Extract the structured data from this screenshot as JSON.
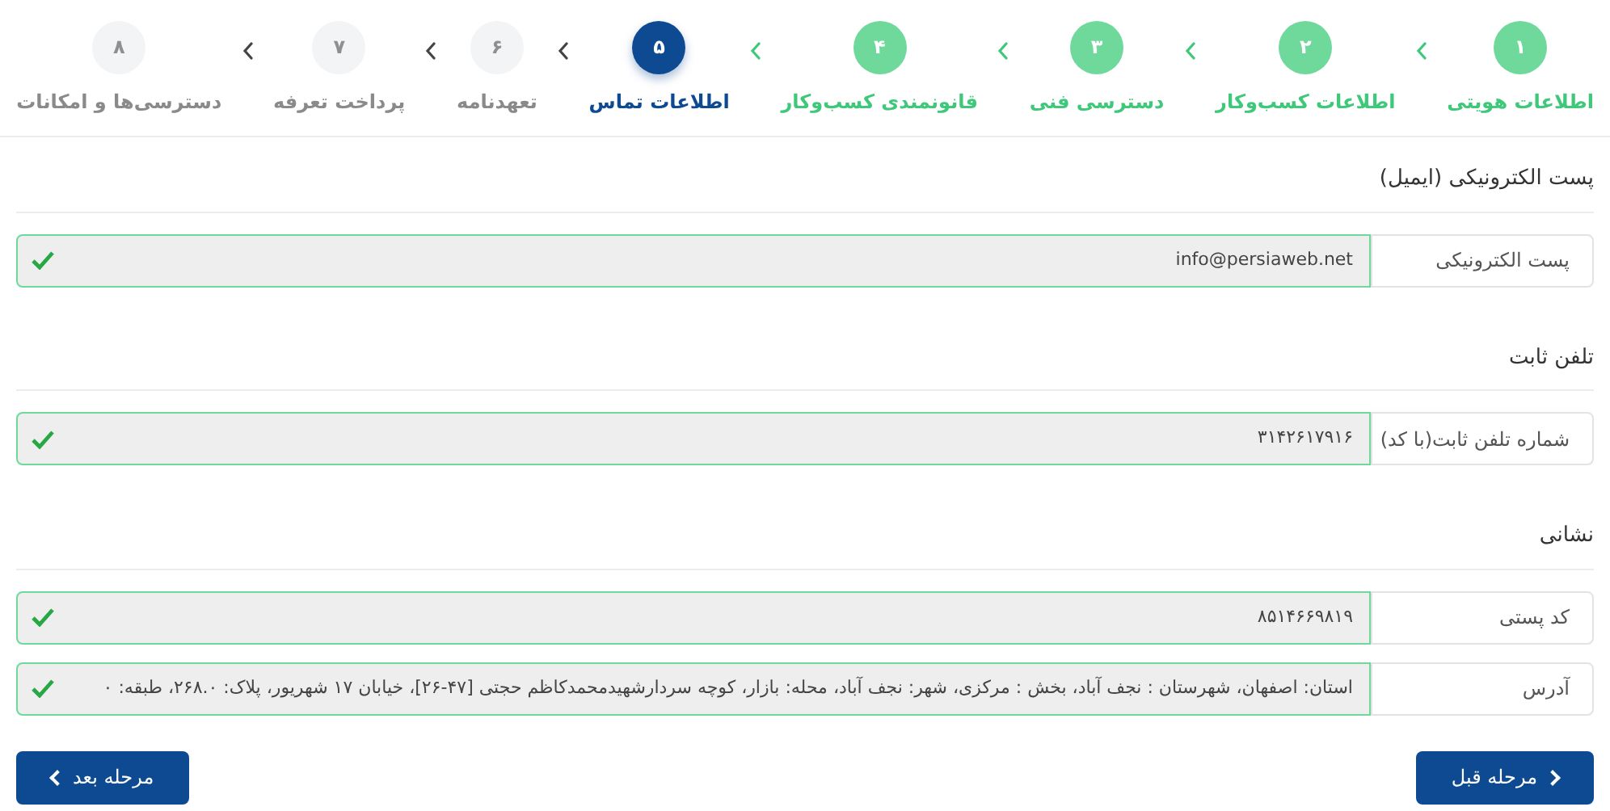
{
  "steps": [
    {
      "number": "۱",
      "label": "اطلاعات هویتی",
      "completed": true,
      "selected": false
    },
    {
      "number": "۲",
      "label": "اطلاعات کسب‌وکار",
      "completed": true,
      "selected": false
    },
    {
      "number": "۳",
      "label": "دسترسی فنی",
      "completed": true,
      "selected": false
    },
    {
      "number": "۴",
      "label": "قانونمندی کسب‌وکار",
      "completed": true,
      "selected": false
    },
    {
      "number": "۵",
      "label": "اطلاعات تماس",
      "completed": false,
      "selected": true
    },
    {
      "number": "۶",
      "label": "تعهدنامه",
      "completed": false,
      "selected": false
    },
    {
      "number": "۷",
      "label": "پرداخت تعرفه",
      "completed": false,
      "selected": false
    },
    {
      "number": "۸",
      "label": "دسترسی‌ها و امکانات",
      "completed": false,
      "selected": false
    }
  ],
  "sections": [
    {
      "title": "پست الکترونیکی (ایمیل)",
      "fields": [
        {
          "label": "پست الکترونیکی",
          "value": "info@persiaweb.net",
          "valid": true
        }
      ]
    },
    {
      "title": "تلفن ثابت",
      "fields": [
        {
          "label": "شماره تلفن ثابت(با کد)",
          "value": "۳۱۴۲۶۱۷۹۱۶",
          "valid": true
        }
      ]
    },
    {
      "title": "نشانی",
      "fields": [
        {
          "label": "کد پستی",
          "value": "۸۵۱۴۶۶۹۸۱۹",
          "valid": true
        },
        {
          "label": "آدرس",
          "value": "استان: اصفهان، شهرستان : نجف آباد، بخش : مرکزی، شهر: نجف آباد، محله: بازار، کوچه سردارشهیدمحمدکاظم حجتی [۴۷-۲۶]، خیابان ۱۷ شهریور، پلاک: ۲۶۸.۰، طبقه: ۰",
          "valid": true
        }
      ]
    }
  ],
  "buttons": {
    "previous": "مرحله قبل",
    "next": "مرحله بعد"
  }
}
